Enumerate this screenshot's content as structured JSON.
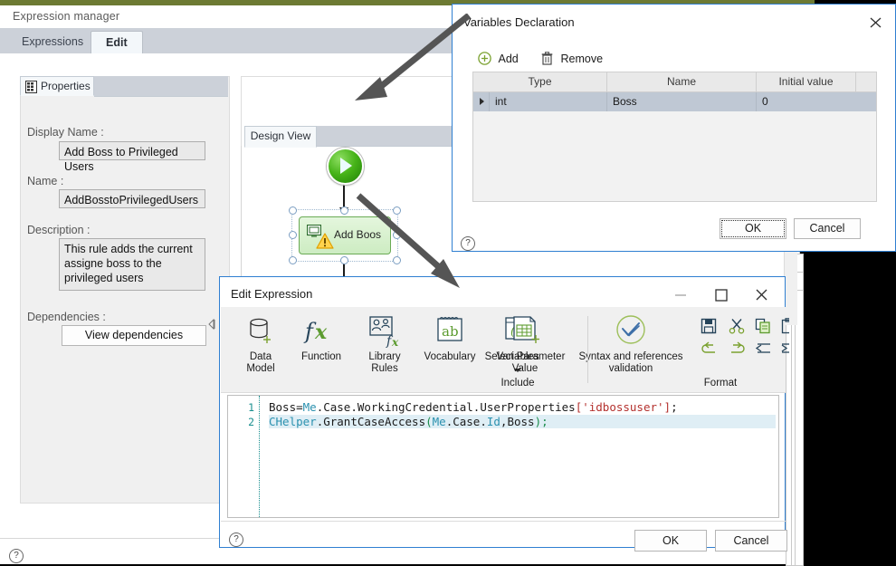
{
  "main_window": {
    "title": "Expression manager",
    "tabs": [
      {
        "label": "Expressions",
        "active": false
      },
      {
        "label": "Edit",
        "active": true
      }
    ],
    "properties_panel": {
      "tab_label": "Properties",
      "tab_icon": "grid-document-icon",
      "fields": [
        {
          "label": "Display Name :",
          "value": "Add Boss to Privileged Users"
        },
        {
          "label": "Name :",
          "value": "AddBosstoPrivilegedUsers"
        },
        {
          "label": "Description :",
          "value": "This rule adds the current assigne boss to the privileged users"
        },
        {
          "label": "Dependencies :",
          "value": "View dependencies"
        }
      ],
      "dependencies_button": "View dependencies"
    },
    "design_view": {
      "tab_label": "Design View",
      "nodes": [
        {
          "id": "start",
          "type": "start-node",
          "label": ""
        },
        {
          "id": "task",
          "type": "task-node",
          "label": "Add Boos"
        },
        {
          "id": "stop",
          "type": "stop-node",
          "label": ""
        }
      ]
    },
    "help_icon": "help-icon"
  },
  "variables_dialog": {
    "title": "Variables Declaration",
    "close_icon": "close-icon",
    "toolbar": [
      {
        "label": "Add",
        "icon": "plus-circle-icon"
      },
      {
        "label": "Remove",
        "icon": "trash-icon"
      }
    ],
    "table": {
      "columns": [
        "Type",
        "Name",
        "Initial value"
      ],
      "rows": [
        {
          "type": "int",
          "name": "Boss",
          "initial_value": "0"
        }
      ]
    },
    "ok_label": "OK",
    "cancel_label": "Cancel",
    "help_icon": "help-icon"
  },
  "expression_dialog": {
    "title": "Edit Expression",
    "window_buttons": [
      {
        "name": "minimize-icon",
        "glyph": "—"
      },
      {
        "name": "maximize-icon",
        "glyph": "□"
      },
      {
        "name": "close-icon",
        "glyph": "✕"
      }
    ],
    "ribbon": [
      {
        "label": "Data\nModel",
        "icon": "database-add-icon"
      },
      {
        "label": "Function",
        "icon": "fx-icon"
      },
      {
        "label": "Library\nRules",
        "icon": "people-fx-icon"
      },
      {
        "label": "Vocabulary",
        "icon": "ab-notepad-icon"
      },
      {
        "label": "Variables",
        "icon": "variable-x-icon",
        "sublabel": "Include",
        "has_dropdown": true
      },
      {
        "label": "Select Parameter\nValue",
        "icon": "table-add-icon"
      },
      {
        "label": "Syntax and references\nvalidation",
        "icon": "check-circle-icon"
      }
    ],
    "format_group": {
      "label": "Format",
      "buttons": [
        {
          "name": "save-icon"
        },
        {
          "name": "cut-icon"
        },
        {
          "name": "copy-icon"
        },
        {
          "name": "paste-icon"
        },
        {
          "name": "undo-icon"
        },
        {
          "name": "redo-icon"
        },
        {
          "name": "outdent-icon"
        },
        {
          "name": "indent-icon"
        }
      ]
    },
    "editor": {
      "lines": [
        {
          "number": "1",
          "text": "Boss=Me.Case.WorkingCredential.UserProperties['idbossuser'];"
        },
        {
          "number": "2",
          "text": "CHelper.GrantCaseAccess(Me.Case.Id,Boss);"
        }
      ]
    },
    "ok_label": "OK",
    "cancel_label": "Cancel",
    "help_icon": "help-icon"
  },
  "colors": {
    "accent_blue": "#2f7fd1",
    "olive_strip": "#6d7a33",
    "tab_bar": "#ccd1d9",
    "node_green": "#46b318",
    "node_red": "#e42d20",
    "code_class": "#2b91af",
    "code_string": "#b4312e",
    "line_number": "#1a8f8f",
    "ribbon_green": "#6aab55"
  }
}
